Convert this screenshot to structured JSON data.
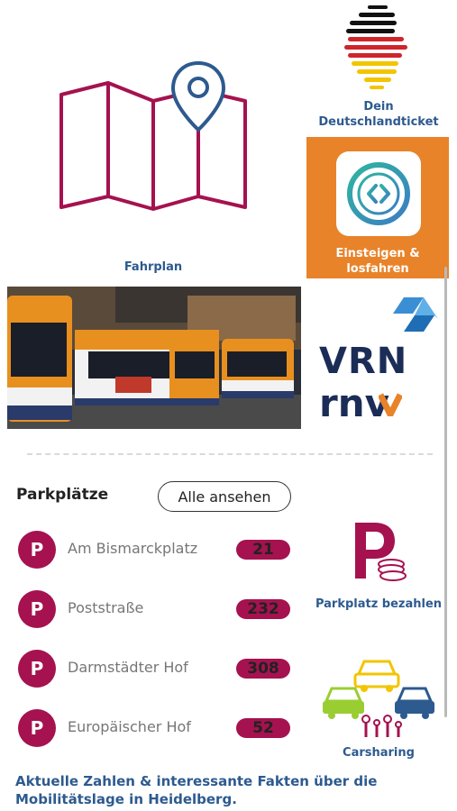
{
  "tiles": {
    "fahrplan": "Fahrplan",
    "dticket": "Dein Deutschlandticket",
    "einsteigen": "Einsteigen & losfahren",
    "parkplatz_bezahlen": "Parkplatz bezahlen",
    "carsharing": "Carsharing"
  },
  "logos": {
    "vrn": "VRN",
    "rnv": "rnv"
  },
  "parking": {
    "title": "Parkplätze",
    "show_all": "Alle ansehen",
    "icon_letter": "P",
    "items": [
      {
        "name": "Am Bismarckplatz",
        "count": "21"
      },
      {
        "name": "Poststraße",
        "count": "232"
      },
      {
        "name": "Darmstädter Hof",
        "count": "308"
      },
      {
        "name": "Europäischer Hof",
        "count": "52"
      }
    ]
  },
  "footer": {
    "text": "Aktuelle Zahlen & interessante Fakten über die Mobilitätslage in Heidelberg."
  },
  "colors": {
    "accent_orange": "#e8832a",
    "brand_magenta": "#a5124f",
    "label_blue": "#2d5a8f",
    "vrn_navy": "#1b2d57",
    "rnv_orange": "#e8832a"
  },
  "icons": [
    "map-pin-icon",
    "germany-flag-icon",
    "code-brackets-icon",
    "parking-coins-icon",
    "cars-people-icon"
  ]
}
